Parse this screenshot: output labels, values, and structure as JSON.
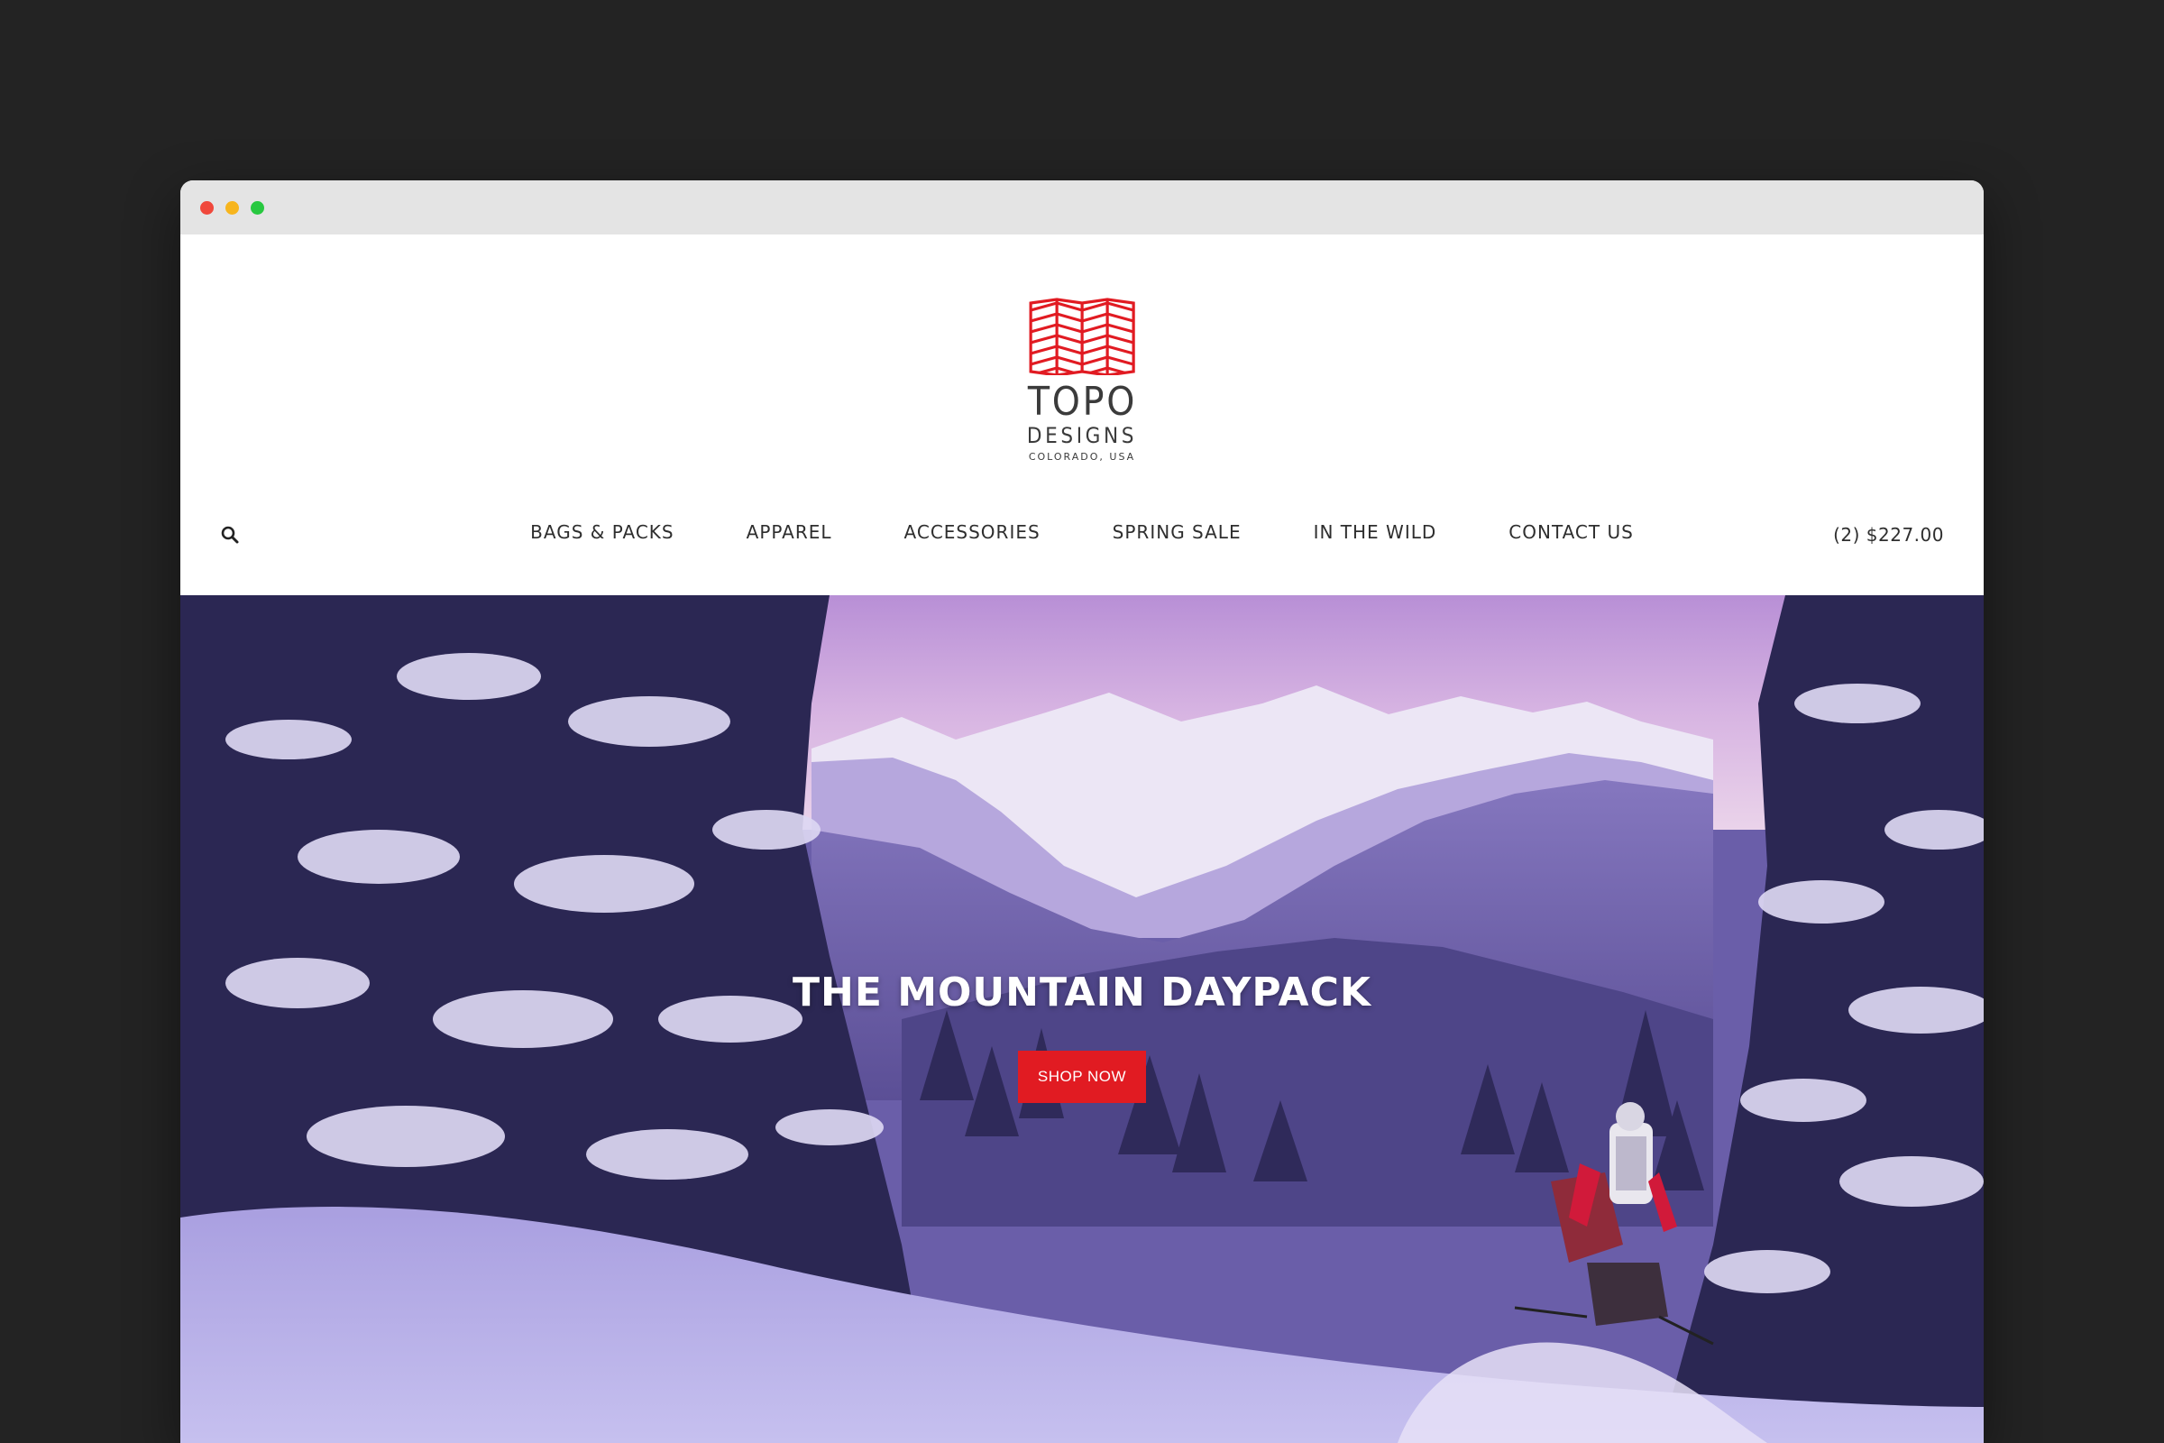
{
  "window": {
    "controls": [
      "close",
      "minimize",
      "maximize"
    ]
  },
  "brand": {
    "name": "TOPO",
    "subname": "DESIGNS",
    "location": "COLORADO, USA",
    "logo_color": "#e11b22"
  },
  "header": {
    "search_icon": "search-icon",
    "nav": [
      {
        "label": "BAGS & PACKS"
      },
      {
        "label": "APPAREL"
      },
      {
        "label": "ACCESSORIES"
      },
      {
        "label": "SPRING SALE"
      },
      {
        "label": "IN THE WILD"
      },
      {
        "label": "CONTACT US"
      }
    ],
    "cart_label": "(2) $227.00"
  },
  "hero": {
    "headline": "THE MOUNTAIN DAYPACK",
    "cta_label": "SHOP NOW",
    "cta_color": "#e11b22"
  }
}
